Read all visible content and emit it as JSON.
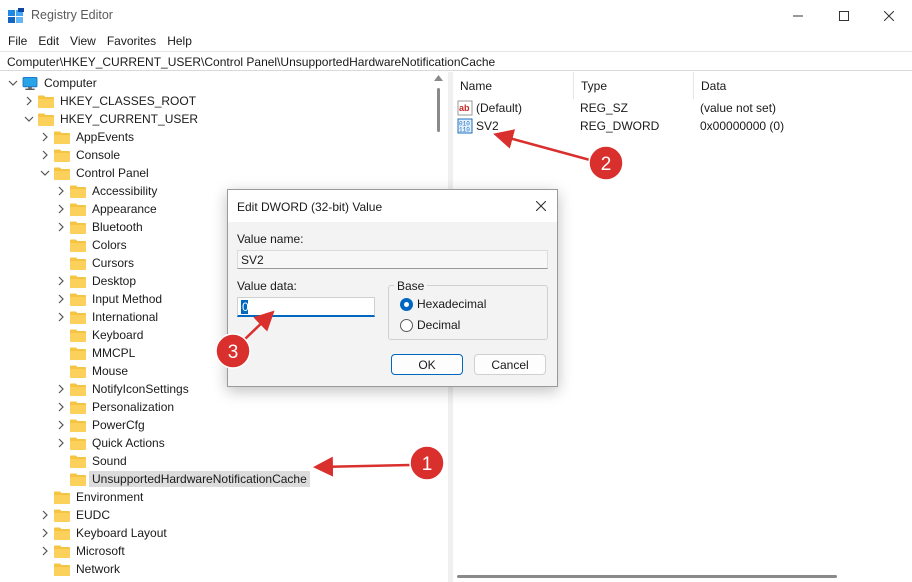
{
  "window": {
    "title": "Registry Editor",
    "accent": "#0067c0",
    "callout_color": "#d9302d"
  },
  "menu": [
    "File",
    "Edit",
    "View",
    "Favorites",
    "Help"
  ],
  "address": "Computer\\HKEY_CURRENT_USER\\Control Panel\\UnsupportedHardwareNotificationCache",
  "tree": [
    {
      "label": "Computer",
      "depth": 0,
      "expander": "expanded",
      "icon": "computer-icon"
    },
    {
      "label": "HKEY_CLASSES_ROOT",
      "depth": 1,
      "expander": "collapsed",
      "icon": "folder-icon"
    },
    {
      "label": "HKEY_CURRENT_USER",
      "depth": 1,
      "expander": "expanded",
      "icon": "folder-icon"
    },
    {
      "label": "AppEvents",
      "depth": 2,
      "expander": "collapsed",
      "icon": "folder-icon"
    },
    {
      "label": "Console",
      "depth": 2,
      "expander": "collapsed",
      "icon": "folder-icon"
    },
    {
      "label": "Control Panel",
      "depth": 2,
      "expander": "expanded",
      "icon": "folder-icon"
    },
    {
      "label": "Accessibility",
      "depth": 3,
      "expander": "collapsed",
      "icon": "folder-icon"
    },
    {
      "label": "Appearance",
      "depth": 3,
      "expander": "collapsed",
      "icon": "folder-icon"
    },
    {
      "label": "Bluetooth",
      "depth": 3,
      "expander": "collapsed",
      "icon": "folder-icon"
    },
    {
      "label": "Colors",
      "depth": 3,
      "expander": "none",
      "icon": "folder-icon"
    },
    {
      "label": "Cursors",
      "depth": 3,
      "expander": "none",
      "icon": "folder-icon"
    },
    {
      "label": "Desktop",
      "depth": 3,
      "expander": "collapsed",
      "icon": "folder-icon"
    },
    {
      "label": "Input Method",
      "depth": 3,
      "expander": "collapsed",
      "icon": "folder-icon"
    },
    {
      "label": "International",
      "depth": 3,
      "expander": "collapsed",
      "icon": "folder-icon"
    },
    {
      "label": "Keyboard",
      "depth": 3,
      "expander": "none",
      "icon": "folder-icon"
    },
    {
      "label": "MMCPL",
      "depth": 3,
      "expander": "none",
      "icon": "folder-icon"
    },
    {
      "label": "Mouse",
      "depth": 3,
      "expander": "none",
      "icon": "folder-icon"
    },
    {
      "label": "NotifyIconSettings",
      "depth": 3,
      "expander": "collapsed",
      "icon": "folder-icon"
    },
    {
      "label": "Personalization",
      "depth": 3,
      "expander": "collapsed",
      "icon": "folder-icon"
    },
    {
      "label": "PowerCfg",
      "depth": 3,
      "expander": "collapsed",
      "icon": "folder-icon"
    },
    {
      "label": "Quick Actions",
      "depth": 3,
      "expander": "collapsed",
      "icon": "folder-icon"
    },
    {
      "label": "Sound",
      "depth": 3,
      "expander": "none",
      "icon": "folder-icon"
    },
    {
      "label": "UnsupportedHardwareNotificationCache",
      "depth": 3,
      "expander": "none",
      "icon": "folder-icon",
      "selected": true
    },
    {
      "label": "Environment",
      "depth": 2,
      "expander": "none",
      "icon": "folder-icon"
    },
    {
      "label": "EUDC",
      "depth": 2,
      "expander": "collapsed",
      "icon": "folder-icon"
    },
    {
      "label": "Keyboard Layout",
      "depth": 2,
      "expander": "collapsed",
      "icon": "folder-icon"
    },
    {
      "label": "Microsoft",
      "depth": 2,
      "expander": "collapsed",
      "icon": "folder-icon"
    },
    {
      "label": "Network",
      "depth": 2,
      "expander": "none",
      "icon": "folder-icon"
    }
  ],
  "values": {
    "columns": [
      "Name",
      "Type",
      "Data"
    ],
    "rows": [
      {
        "name": "(Default)",
        "type": "REG_SZ",
        "data": "(value not set)",
        "icon": "string-value-icon"
      },
      {
        "name": "SV2",
        "type": "REG_DWORD",
        "data": "0x00000000 (0)",
        "icon": "binary-value-icon"
      }
    ]
  },
  "dialog": {
    "title": "Edit DWORD (32-bit) Value",
    "value_name_label": "Value name:",
    "value_name": "SV2",
    "value_data_label": "Value data:",
    "value_data": "0",
    "base_label": "Base",
    "base_options": [
      "Hexadecimal",
      "Decimal"
    ],
    "base_selected": "Hexadecimal",
    "ok_label": "OK",
    "cancel_label": "Cancel"
  },
  "callouts": [
    "1",
    "2",
    "3"
  ]
}
